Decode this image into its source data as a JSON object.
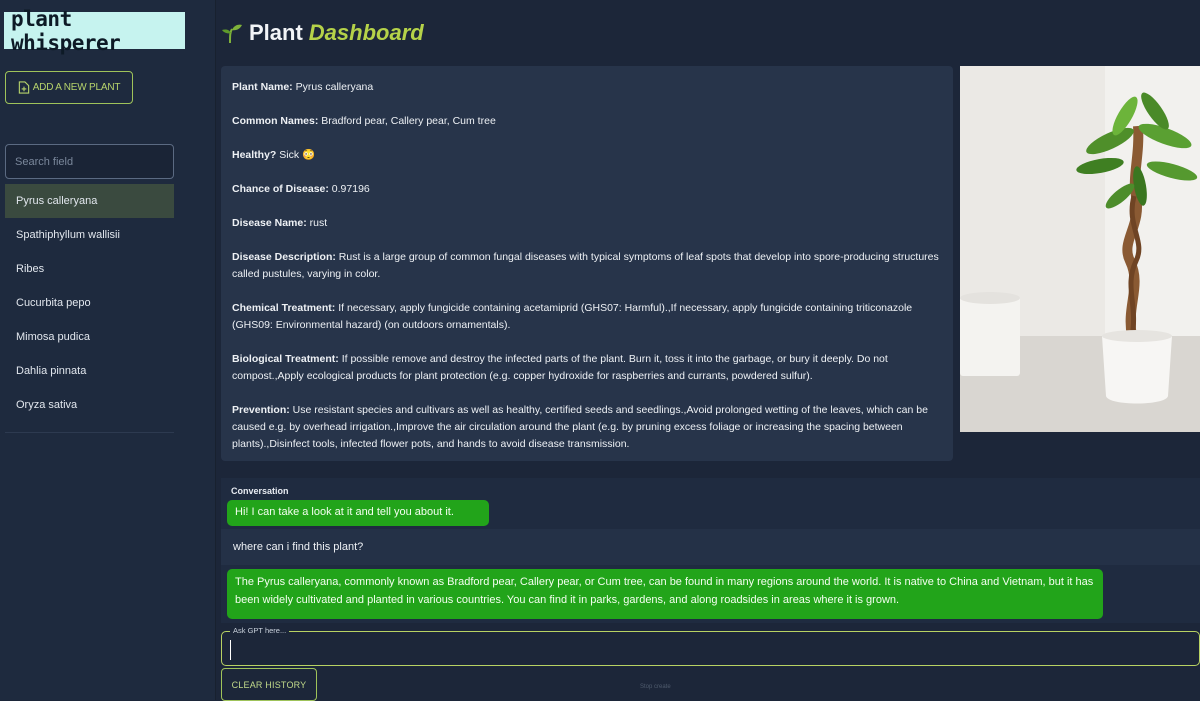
{
  "app": {
    "logo_text": "plant whisperer",
    "add_button_label": "ADD A NEW PLANT",
    "search_placeholder": "Search field"
  },
  "sidebar": {
    "plants": [
      {
        "label": "Pyrus calleryana",
        "active": true
      },
      {
        "label": "Spathiphyllum wallisii",
        "active": false
      },
      {
        "label": "Ribes",
        "active": false
      },
      {
        "label": "Cucurbita pepo",
        "active": false
      },
      {
        "label": "Mimosa pudica",
        "active": false
      },
      {
        "label": "Dahlia pinnata",
        "active": false
      },
      {
        "label": "Oryza sativa",
        "active": false
      }
    ]
  },
  "header": {
    "title_plain": "Plant",
    "title_accent": "Dashboard",
    "icon": "sprout-icon"
  },
  "plant_info": {
    "plant_name": {
      "label": "Plant Name:",
      "value": " Pyrus calleryana"
    },
    "common_names": {
      "label": "Common Names:",
      "value": " Bradford pear, Callery pear, Cum tree"
    },
    "healthy": {
      "label": "Healthy?",
      "value": " Sick 😳"
    },
    "chance_of_disease": {
      "label": "Chance of Disease:",
      "value": " 0.97196"
    },
    "disease_name": {
      "label": "Disease Name:",
      "value": " rust"
    },
    "disease_description": {
      "label": "Disease Description:",
      "value": " Rust is a large group of common fungal diseases with typical symptoms of leaf spots that develop into spore-producing structures called pustules, varying in color."
    },
    "chemical_treatment": {
      "label": "Chemical Treatment:",
      "value": " If necessary, apply fungicide containing acetamiprid (GHS07: Harmful).,If necessary, apply fungicide containing triticonazole (GHS09: Environmental hazard) (on outdoors ornamentals)."
    },
    "biological_treatment": {
      "label": "Biological Treatment:",
      "value": " If possible remove and destroy the infected parts of the plant. Burn it, toss it into the garbage, or bury it deeply. Do not compost.,Apply ecological products for plant protection (e.g. copper hydroxide for raspberries and currants, powdered sulfur)."
    },
    "prevention": {
      "label": "Prevention:",
      "value": " Use resistant species and cultivars as well as healthy, certified seeds and seedlings.,Avoid prolonged wetting of the leaves, which can be caused e.g. by overhead irrigation.,Improve the air circulation around the plant (e.g. by pruning excess foliage or increasing the spacing between plants).,Disinfect tools, infected flower pots, and hands to avoid disease transmission."
    }
  },
  "conversation": {
    "label": "Conversation",
    "messages": [
      {
        "role": "bot",
        "text": "Hi! I can take a look at it and tell you about it."
      },
      {
        "role": "user",
        "text": "where can i find this plant?"
      },
      {
        "role": "bot",
        "text": "The Pyrus calleryana, commonly known as Bradford pear, Callery pear, or Cum tree, can be found in many regions around the world. It is native to China and Vietnam, but it has been widely cultivated and planted in various countries. You can find it in parks, gardens, and along roadsides in areas where it is grown."
      }
    ]
  },
  "ask": {
    "label": "Ask GPT here...",
    "value": ""
  },
  "clear_button_label": "CLEAR HISTORY",
  "footer_note": "Stop create",
  "colors": {
    "background": "#1c2639",
    "accent_green": "#b5d249",
    "bot_bubble": "#22a41a",
    "logo_bg": "#c6f3ef"
  }
}
